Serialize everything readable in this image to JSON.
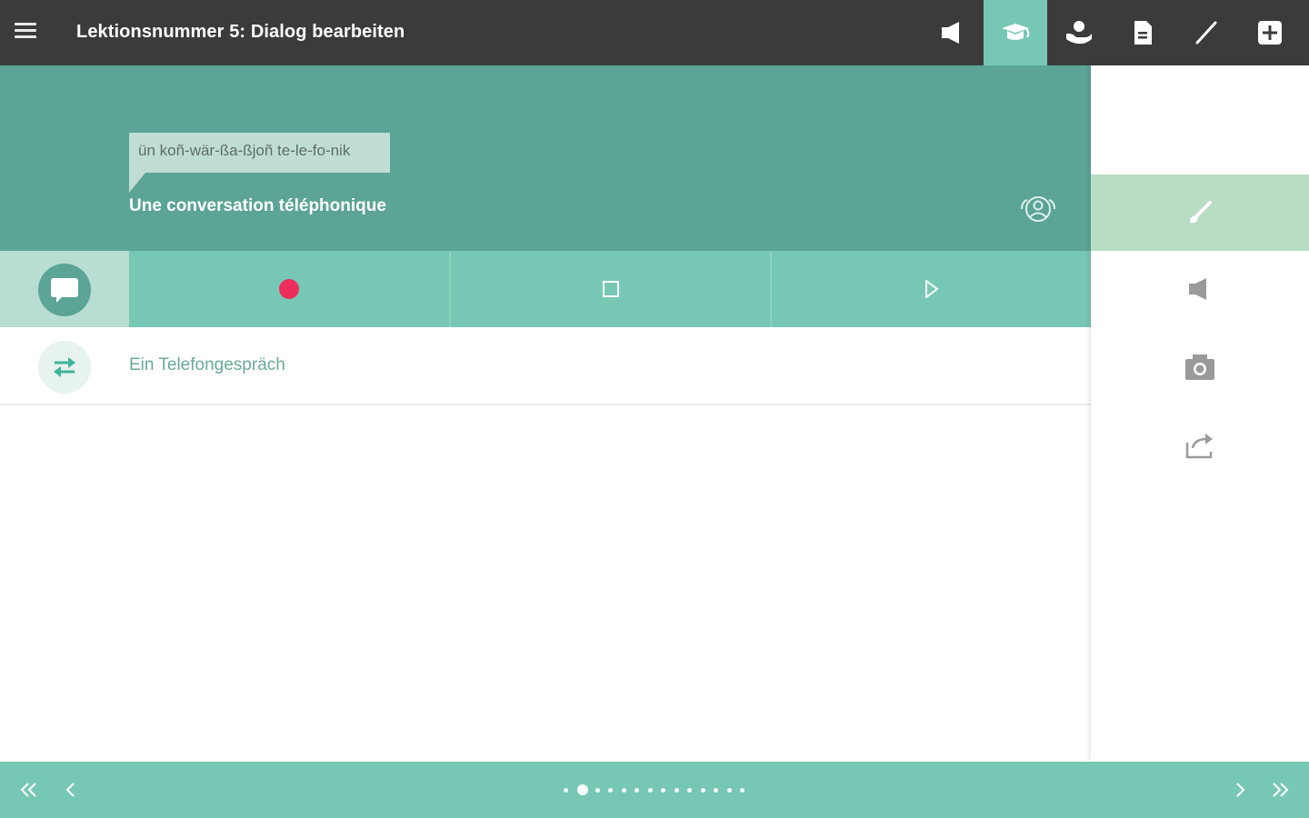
{
  "header_bar": {
    "title": "Lektionsnummer 5: Dialog bearbeiten",
    "tools": [
      {
        "name": "audio-icon",
        "active": false
      },
      {
        "name": "graduation-cap-icon",
        "active": true
      },
      {
        "name": "hand-award-icon",
        "active": false
      },
      {
        "name": "document-icon",
        "active": false
      },
      {
        "name": "pen-icon",
        "active": false
      },
      {
        "name": "add-icon",
        "active": false
      }
    ]
  },
  "dialog": {
    "phonetic": "ün koñ-wär-ßa-ßjoñ te-le-fo-nik",
    "subtitle": "Une conversation téléphonique"
  },
  "translation": {
    "text": "Ein Telefongespräch"
  },
  "side_panel": {
    "items": [
      "brush-icon",
      "audio-icon",
      "camera-icon",
      "share-icon"
    ],
    "active_index": 0
  },
  "pagination": {
    "total_pages": 14,
    "current_page": 2
  },
  "colors": {
    "topbar": "#3b3b3b",
    "teal_dark": "#5ba496",
    "teal": "#77c7b5",
    "teal_light": "#b8ddd3",
    "record": "#ee2d5a"
  }
}
